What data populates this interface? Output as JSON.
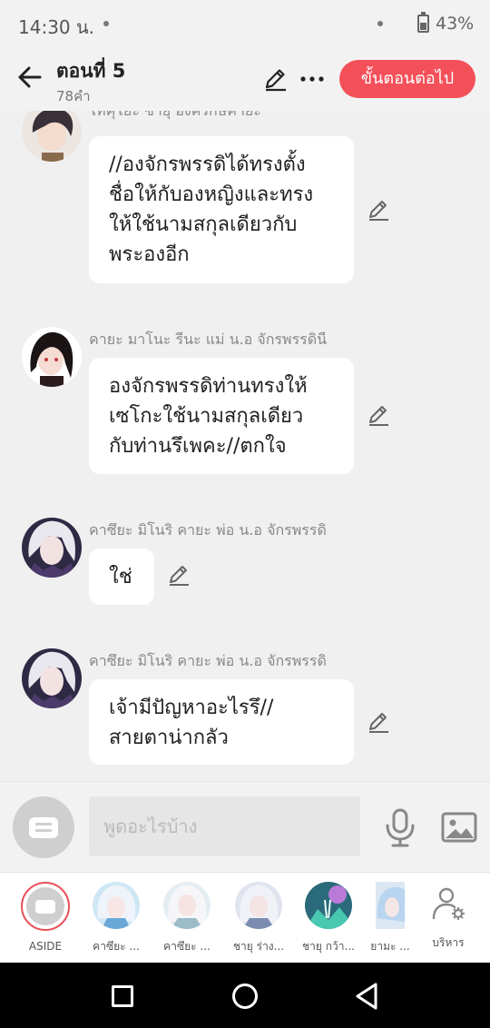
{
  "status_bar": {
    "time": "14:30 น.",
    "battery": "43%"
  },
  "header": {
    "title": "ตอนที่ 5",
    "subtitle": "78คำ",
    "next_button": "ขั้นตอนต่อไป"
  },
  "messages": [
    {
      "sender": "ไทคุโยะ ซายุ องครักษ์คายะ",
      "text": "//องจักรพรรดิได้ทรงตั้ง\nชื่อให้กับองหญิงและทรง\nให้ใช้นามสกุลเดียวกับ\nพระองอีก"
    },
    {
      "sender": "คายะ มาโนะ รีนะ แม่ น.อ จักรพรรดินี",
      "text": "องจักรพรรดิท่านทรงให้\nเซโกะใช้นามสกุลเดียว\nกับท่านรึเพคะ//ตกใจ"
    },
    {
      "sender": "คาซึยะ มิโนริ คายะ พ่อ น.อ จักรพรรดิ",
      "text": "ใช่"
    },
    {
      "sender": "คาซึยะ มิโนริ คายะ พ่อ น.อ จักรพรรดิ",
      "text": "เจ้ามีปัญหาอะไรรึ//\nสายตาน่ากลัว"
    }
  ],
  "input": {
    "placeholder": "พูดอะไรบ้าง"
  },
  "characters": [
    {
      "label": "ASIDE"
    },
    {
      "label": "คาซึยะ ..."
    },
    {
      "label": "คาซึยะ ..."
    },
    {
      "label": "ชายุ ร่าง..."
    },
    {
      "label": "ชายุ กว้า..."
    },
    {
      "label": "ยามะ ..."
    },
    {
      "label": "บริหาร"
    }
  ],
  "colors": {
    "accent": "#f4505a",
    "bubble": "#ffffff",
    "background": "#f0f0f0"
  }
}
